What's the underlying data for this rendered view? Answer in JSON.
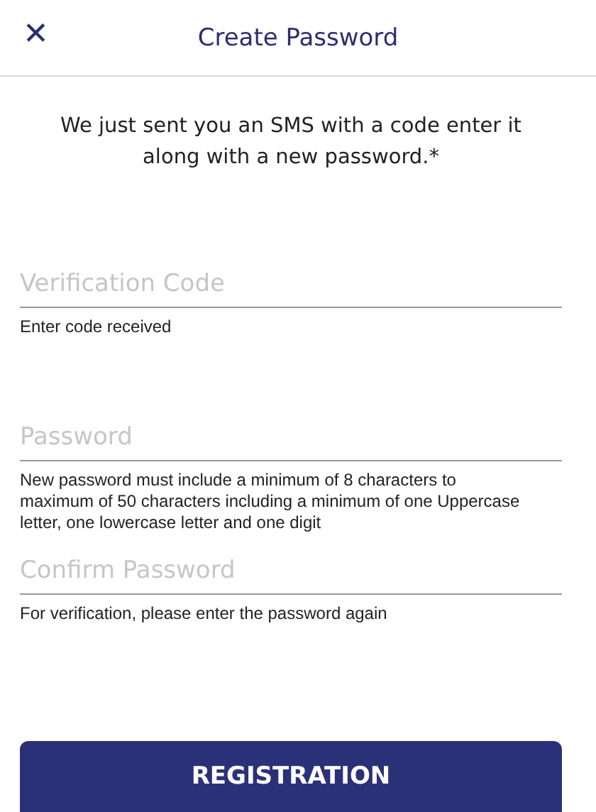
{
  "header": {
    "close": "✕",
    "title": "Create Password"
  },
  "intro": "We just sent you an SMS with a code enter it along with a new password.*",
  "fields": [
    {
      "placeholder": "Verification Code",
      "hint": "Enter code received"
    },
    {
      "placeholder": "Password",
      "hint": "New password must include a minimum of 8 characters to maximum of 50 characters including a minimum of one Uppercase letter, one lowercase letter and one digit"
    },
    {
      "placeholder": "Confirm Password",
      "hint": "For verification, please enter the password again"
    }
  ],
  "button": "REGISTRATION"
}
